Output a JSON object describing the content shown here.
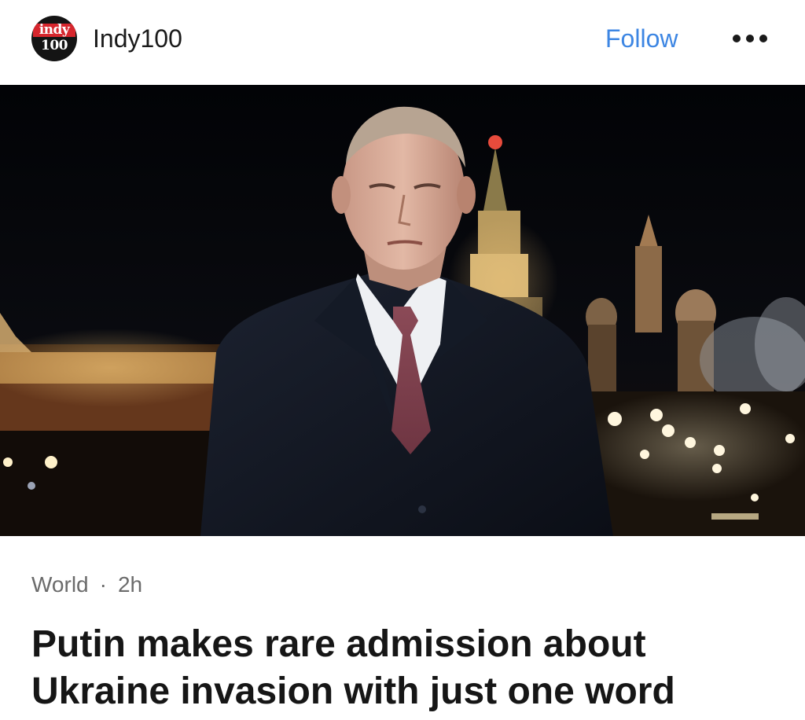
{
  "header": {
    "logo": {
      "top_text": "indy",
      "bottom_text": "100"
    },
    "publisher_name": "Indy100",
    "follow_label": "Follow",
    "more_icon": "more-horizontal-icon"
  },
  "article": {
    "hero_image": "news-photo",
    "category": "World",
    "separator": "·",
    "age": "2h",
    "headline_lines": [
      "Putin makes rare admission about",
      "Ukraine invasion with just one word"
    ]
  },
  "colors": {
    "accent": "#3d86e3",
    "logo_red": "#d6262d",
    "text": "#161616",
    "meta": "#6b6b6b"
  }
}
